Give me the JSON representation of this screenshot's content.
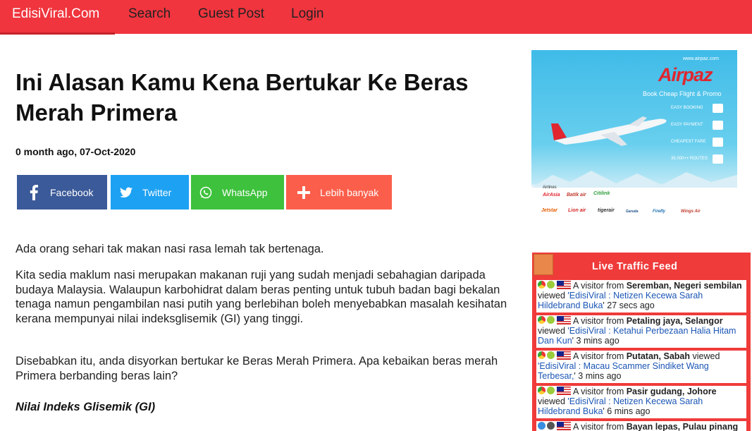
{
  "nav": {
    "brand": "EdisiViral.Com",
    "items": [
      "Search",
      "Guest Post",
      "Login"
    ]
  },
  "article": {
    "title": "Ini Alasan Kamu Kena Bertukar Ke Beras Merah Primera",
    "meta": "0 month ago, 07-Oct-2020",
    "paragraphs": [
      "Ada orang sehari tak makan nasi rasa lemah tak bertenaga.",
      "Kita sedia maklum nasi merupakan makanan ruji yang sudah menjadi sebahagian daripada budaya Malaysia. Walaupun karbohidrat dalam beras penting untuk tubuh badan bagi bekalan tenaga namun pengambilan nasi putih yang berlebihan boleh menyebabkan masalah kesihatan kerana mempunyai nilai indeksglisemik (GI) yang tinggi.",
      "Disebabkan itu, anda disyorkan bertukar ke Beras Merah Primera. Apa kebaikan beras merah Primera berbanding beras lain?"
    ],
    "subheading": "Nilai Indeks Glisemik (GI)"
  },
  "share": {
    "facebook": "Facebook",
    "twitter": "Twitter",
    "whatsapp": "WhatsApp",
    "more": "Lebih banyak"
  },
  "ad": {
    "url": "www.airpaz.com",
    "brand": "Airpaz",
    "tagline": "Book Cheap Flight & Promo",
    "features": [
      "EASY BOOKING",
      "EASY PAYMENT",
      "CHEAPEST FARE",
      "35.000++ ROUTES"
    ],
    "airlines_label": "Airlines",
    "airlines": [
      "AirAsia",
      "Batik air",
      "Citilink",
      "Jetstar",
      "Lion air",
      "tigerair",
      "Garuda",
      "Firefly",
      "Wings Air"
    ]
  },
  "feed": {
    "title": "Live Traffic Feed",
    "items": [
      {
        "prefix": "A visitor from ",
        "place": "Seremban, Negeri sembilan",
        "verb": " viewed ",
        "link": "'EdisiViral : Netizen Kecewa Sarah Hildebrand Buka",
        "time": "' 27 secs ago"
      },
      {
        "prefix": "A visitor from ",
        "place": "Petaling jaya, Selangor",
        "verb": " viewed ",
        "link": "'EdisiViral : Ketahui Perbezaan Halia Hitam Dan Kun",
        "time": "' 3 mins ago"
      },
      {
        "prefix": "A visitor from ",
        "place": "Putatan, Sabah",
        "verb": " viewed ",
        "link": "'EdisiViral : Macau Scammer Sindiket Wang Terbesar,",
        "time": "' 3 mins ago"
      },
      {
        "prefix": "A visitor from ",
        "place": "Pasir gudang, Johore",
        "verb": " viewed ",
        "link": "'EdisiViral : Netizen Kecewa Sarah Hildebrand Buka",
        "time": "' 6 mins ago"
      },
      {
        "prefix": "A visitor from ",
        "place": "Bayan lepas, Pulau pinang",
        "verb": "",
        "link": "",
        "time": ""
      }
    ]
  }
}
